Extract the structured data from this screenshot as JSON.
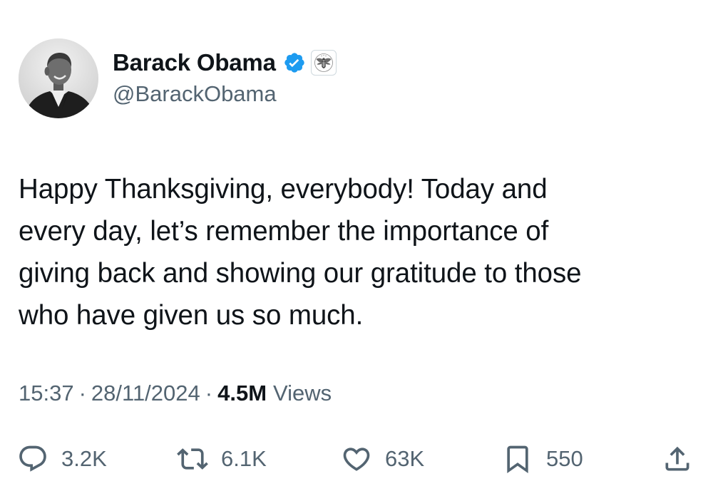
{
  "author": {
    "display_name": "Barack Obama",
    "handle": "@BarackObama",
    "verified": true,
    "affiliation_badge": "seal-icon"
  },
  "tweet": {
    "lines": [
      "Happy Thanksgiving, everybody! Today and",
      "every day, let’s remember the importance of",
      "giving back and showing our gratitude to those",
      "who have given us so much."
    ]
  },
  "meta": {
    "time": "15:37",
    "separator": "·",
    "date": "28/11/2024",
    "views_count": "4.5M",
    "views_label": "Views"
  },
  "actions": {
    "replies": "3.2K",
    "reposts": "6.1K",
    "likes": "63K",
    "bookmarks": "550"
  },
  "colors": {
    "text": "#0f1419",
    "secondary": "#536471",
    "verified_blue": "#1d9bf0",
    "background": "#ffffff"
  }
}
